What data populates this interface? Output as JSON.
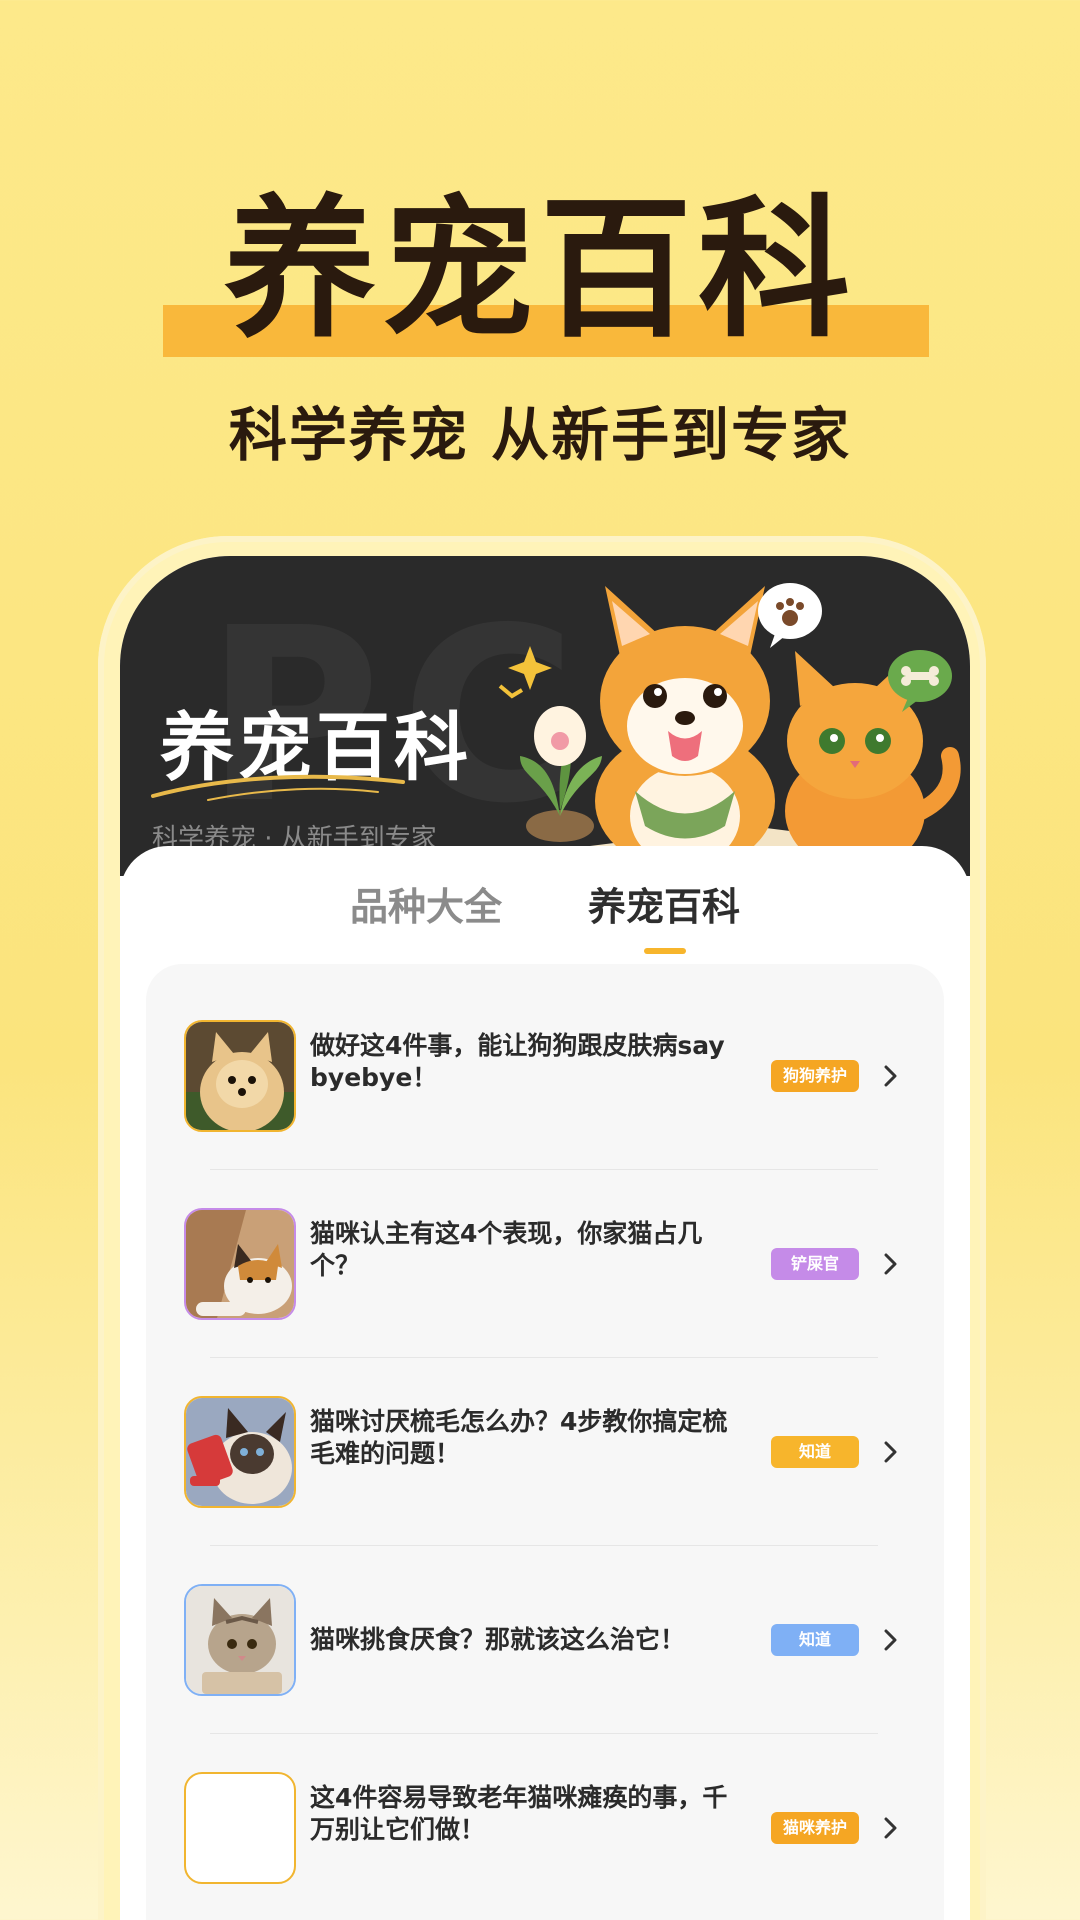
{
  "promo": {
    "title": "养宠百科",
    "subtitle": "科学养宠 从新手到专家"
  },
  "banner": {
    "title": "养宠百科",
    "subtitle": "科学养宠 · 从新手到专家"
  },
  "tabs": [
    {
      "label": "品种大全",
      "active": false
    },
    {
      "label": "养宠百科",
      "active": true
    }
  ],
  "articles": [
    {
      "title": "做好这4件事，能让狗狗跟皮肤病say byebye！",
      "tag": "狗狗养护",
      "tag_color": "#f5a623",
      "thumb_border": "#f1b530",
      "thumb": "pomeranian-dog-photo"
    },
    {
      "title": "猫咪认主有这4个表现，你家猫占几个？",
      "tag": "铲屎官",
      "tag_color": "#c58be8",
      "thumb_border": "#c58be8",
      "thumb": "calico-cat-photo"
    },
    {
      "title": "猫咪讨厌梳毛怎么办？4步教你搞定梳毛难的问题！",
      "tag": "知道",
      "tag_color": "#f7b52c",
      "thumb_border": "#f1b530",
      "thumb": "siamese-cat-brushing-photo"
    },
    {
      "title": "猫咪挑食厌食？那就该这么治它！",
      "tag": "知道",
      "tag_color": "#7fb0f5",
      "thumb_border": "#7fb0f5",
      "thumb": "tabby-cat-bowl-photo"
    },
    {
      "title": "这4件容易导致老年猫咪瘫痪的事，千万别让它们做！",
      "tag": "猫咪养护",
      "tag_color": "#f5a623",
      "thumb_border": "#f1b530",
      "thumb": "empty-thumbnail"
    }
  ]
}
